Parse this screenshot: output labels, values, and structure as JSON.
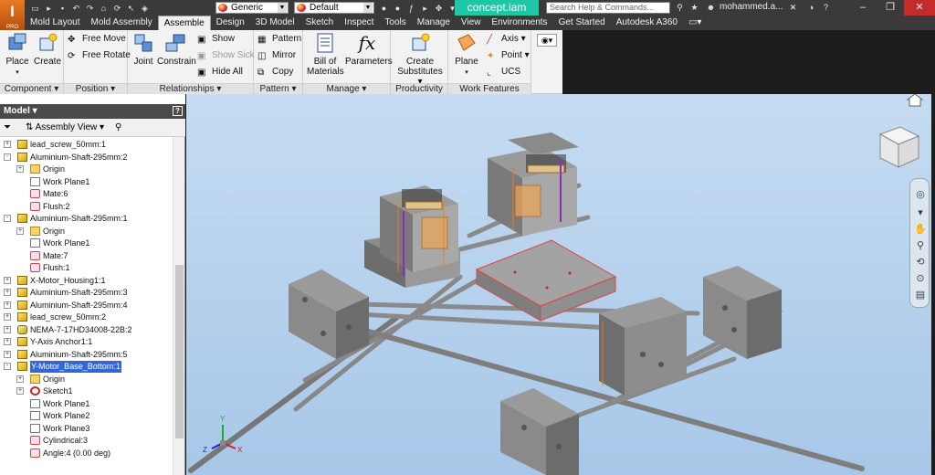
{
  "app": {
    "logo_text": "I",
    "logo_sub": "PRO"
  },
  "quick_access": {
    "style": "Generic",
    "appearance": "Default"
  },
  "document": {
    "title": "concept.iam"
  },
  "search": {
    "placeholder": "Search Help & Commands..."
  },
  "user": {
    "name": "mohammed.a..."
  },
  "tabs": [
    "Mold Layout",
    "Mold Assembly",
    "Assemble",
    "Design",
    "3D Model",
    "Sketch",
    "Inspect",
    "Tools",
    "Manage",
    "View",
    "Environments",
    "Get Started",
    "Autodesk A360"
  ],
  "active_tab": "Assemble",
  "ribbon": {
    "component": {
      "title": "Component",
      "place": "Place",
      "create": "Create"
    },
    "position": {
      "title": "Position",
      "free_move": "Free Move",
      "free_rotate": "Free Rotate"
    },
    "relationships": {
      "title": "Relationships",
      "joint": "Joint",
      "constrain": "Constrain",
      "show": "Show",
      "show_sick": "Show Sick",
      "hide_all": "Hide All"
    },
    "pattern": {
      "title": "Pattern",
      "pattern": "Pattern",
      "mirror": "Mirror",
      "copy": "Copy"
    },
    "manage": {
      "title": "Manage",
      "bom_line1": "Bill of",
      "bom_line2": "Materials",
      "parameters": "Parameters"
    },
    "productivity": {
      "title": "Productivity",
      "line1": "Create",
      "line2": "Substitutes"
    },
    "work_features": {
      "title": "Work Features",
      "plane": "Plane",
      "axis": "Axis",
      "point": "Point",
      "ucs": "UCS"
    }
  },
  "browser": {
    "title": "Model",
    "view": "Assembly View",
    "items": [
      {
        "label": "lead_screw_50mm:1",
        "icon": "part",
        "level": 0,
        "exp": "+"
      },
      {
        "label": "Aluminium-Shaft-295mm:2",
        "icon": "part",
        "level": 0,
        "exp": "-"
      },
      {
        "label": "Origin",
        "icon": "folder",
        "level": 1,
        "exp": "+"
      },
      {
        "label": "Work Plane1",
        "icon": "plane",
        "level": 1,
        "exp": ""
      },
      {
        "label": "Mate:6",
        "icon": "constraint",
        "level": 1,
        "exp": ""
      },
      {
        "label": "Flush:2",
        "icon": "constraint",
        "level": 1,
        "exp": ""
      },
      {
        "label": "Aluminium-Shaft-295mm:1",
        "icon": "part",
        "level": 0,
        "exp": "-"
      },
      {
        "label": "Origin",
        "icon": "folder",
        "level": 1,
        "exp": "+"
      },
      {
        "label": "Work Plane1",
        "icon": "plane",
        "level": 1,
        "exp": ""
      },
      {
        "label": "Mate:7",
        "icon": "constraint",
        "level": 1,
        "exp": ""
      },
      {
        "label": "Flush:1",
        "icon": "constraint",
        "level": 1,
        "exp": ""
      },
      {
        "label": "X-Motor_Housing1:1",
        "icon": "part",
        "level": 0,
        "exp": "+"
      },
      {
        "label": "Aluminium-Shaft-295mm:3",
        "icon": "part",
        "level": 0,
        "exp": "+"
      },
      {
        "label": "Aluminium-Shaft-295mm:4",
        "icon": "part",
        "level": 0,
        "exp": "+"
      },
      {
        "label": "lead_screw_50mm:2",
        "icon": "part",
        "level": 0,
        "exp": "+"
      },
      {
        "label": "NEMA-7-17HD34008-22B:2",
        "icon": "motor",
        "level": 0,
        "exp": "+"
      },
      {
        "label": "Y-Axis Anchor1:1",
        "icon": "part",
        "level": 0,
        "exp": "+"
      },
      {
        "label": "Aluminium-Shaft-295mm:5",
        "icon": "part",
        "level": 0,
        "exp": "+"
      },
      {
        "label": "Y-Motor_Base_Bottom:1",
        "icon": "part",
        "level": 0,
        "exp": "-",
        "selected": true
      },
      {
        "label": "Origin",
        "icon": "folder",
        "level": 1,
        "exp": "+"
      },
      {
        "label": "Sketch1",
        "icon": "sketch",
        "level": 1,
        "exp": "+"
      },
      {
        "label": "Work Plane1",
        "icon": "plane",
        "level": 1,
        "exp": ""
      },
      {
        "label": "Work Plane2",
        "icon": "plane",
        "level": 1,
        "exp": ""
      },
      {
        "label": "Work Plane3",
        "icon": "plane",
        "level": 1,
        "exp": ""
      },
      {
        "label": "Cylindrical:3",
        "icon": "constraint",
        "level": 1,
        "exp": ""
      },
      {
        "label": "Angle:4 (0.00 deg)",
        "icon": "constraint",
        "level": 1,
        "exp": ""
      }
    ]
  },
  "triad": {
    "x": "X",
    "y": "Y",
    "z": "Z"
  },
  "colors": {
    "selection": "#3367d6",
    "doc_tab": "#1ec7a6",
    "viewport_top": "#c5dcf2"
  }
}
